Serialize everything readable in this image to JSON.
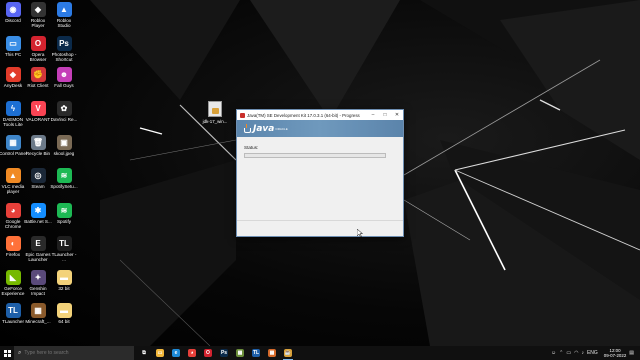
{
  "desktop": {
    "icons": [
      {
        "label": "Discord",
        "color": "#5865f2",
        "glyph": "◉"
      },
      {
        "label": "Roblox Player",
        "color": "#333333",
        "glyph": "◆"
      },
      {
        "label": "Roblox Studio",
        "color": "#2c7be5",
        "glyph": "▲"
      },
      {
        "label": "This PC",
        "color": "#3a8ee6",
        "glyph": "▭"
      },
      {
        "label": "Opera Browser",
        "color": "#d3232f",
        "glyph": "O"
      },
      {
        "label": "Photoshop - Shortcut",
        "color": "#0b2a4a",
        "glyph": "Ps"
      },
      {
        "label": "AnyDesk",
        "color": "#e23b2a",
        "glyph": "◆"
      },
      {
        "label": "Riot Client",
        "color": "#d13639",
        "glyph": "✊"
      },
      {
        "label": "Fall Guys",
        "color": "#c53fb8",
        "glyph": "☻"
      },
      {
        "label": "DAEMON Tools Lite",
        "color": "#1d6fd3",
        "glyph": "ϟ"
      },
      {
        "label": "VALORANT",
        "color": "#fa4454",
        "glyph": "V"
      },
      {
        "label": "DaVinci Re...",
        "color": "#2a2a2a",
        "glyph": "✿"
      },
      {
        "label": "Control Panel",
        "color": "#3f86c9",
        "glyph": "▦"
      },
      {
        "label": "Recycle Bin",
        "color": "#6c7a89",
        "glyph": "🗑"
      },
      {
        "label": "skool.jpeg",
        "color": "#7a6a55",
        "glyph": "▣"
      },
      {
        "label": "VLC media player",
        "color": "#f08a24",
        "glyph": "▲"
      },
      {
        "label": "Steam",
        "color": "#1b2838",
        "glyph": "◎"
      },
      {
        "label": "SpotifySetu...",
        "color": "#1db954",
        "glyph": "≋"
      },
      {
        "label": "Google Chrome",
        "color": "#e7403a",
        "glyph": "◕"
      },
      {
        "label": "Battle.net S...",
        "color": "#148eff",
        "glyph": "✱"
      },
      {
        "label": "Spotify",
        "color": "#1db954",
        "glyph": "≋"
      },
      {
        "label": "Firefox",
        "color": "#ff7139",
        "glyph": "◐"
      },
      {
        "label": "Epic Games Launcher",
        "color": "#2a2a2a",
        "glyph": "E"
      },
      {
        "label": "TLauncher - ...",
        "color": "#1e1e1e",
        "glyph": "TL"
      },
      {
        "label": "GeForce Experience",
        "color": "#76b900",
        "glyph": "◣"
      },
      {
        "label": "Genshin Impact",
        "color": "#5a4a7a",
        "glyph": "✦"
      },
      {
        "label": "32 bit",
        "color": "#f3d27a",
        "glyph": "▬"
      },
      {
        "label": "TLauncher",
        "color": "#1e5fa8",
        "glyph": "TL"
      },
      {
        "label": "Minecraft_...",
        "color": "#8a5a2b",
        "glyph": "▦"
      },
      {
        "label": "64 bit",
        "color": "#f3d27a",
        "glyph": "▬"
      }
    ],
    "file": {
      "label": "jdk-17_win..."
    }
  },
  "installer": {
    "title": "Java(TM) SE Development Kit 17.0.3.1 (64-bit) - Progress",
    "logo_text": "Java",
    "logo_sub": "ORACLE",
    "status_label": "Status:",
    "progress": 0
  },
  "taskbar": {
    "search_placeholder": "Type here to search",
    "apps": [
      {
        "name": "task-view",
        "glyph": "⧉",
        "color": "#101010"
      },
      {
        "name": "file-explorer",
        "glyph": "▭",
        "color": "#f3b83b"
      },
      {
        "name": "edge",
        "glyph": "e",
        "color": "#1e8ad6"
      },
      {
        "name": "chrome",
        "glyph": "◕",
        "color": "#e7403a"
      },
      {
        "name": "opera",
        "glyph": "O",
        "color": "#d3232f"
      },
      {
        "name": "photoshop",
        "glyph": "Ps",
        "color": "#0b2a4a"
      },
      {
        "name": "minecraft",
        "glyph": "▦",
        "color": "#6b8e3a"
      },
      {
        "name": "tlauncher",
        "glyph": "TL",
        "color": "#1e5fa8"
      },
      {
        "name": "calculator",
        "glyph": "▦",
        "color": "#d66a2a"
      },
      {
        "name": "java-installer",
        "glyph": "☕",
        "color": "#d9a13a"
      }
    ],
    "tray": {
      "lang": "ENG",
      "time": "12:00",
      "date": "09-07-2022"
    }
  }
}
